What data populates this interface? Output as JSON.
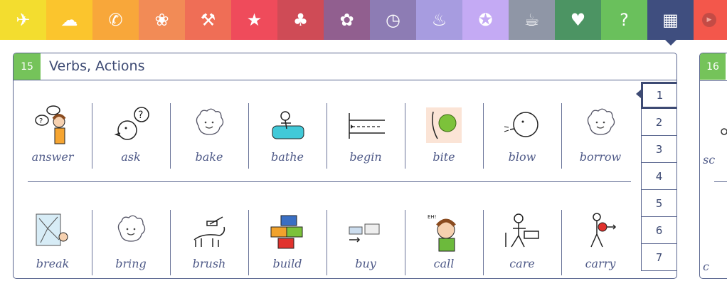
{
  "tabs": [
    {
      "icon": "airplane-icon",
      "glyph": "✈",
      "color": "#f3dd2f"
    },
    {
      "icon": "cloud-icon",
      "glyph": "☁",
      "color": "#fbc52d"
    },
    {
      "icon": "telephone-icon",
      "glyph": "✆",
      "color": "#f8a73a"
    },
    {
      "icon": "rabbit-icon",
      "glyph": "❀",
      "color": "#f28b56"
    },
    {
      "icon": "hammer-icon",
      "glyph": "⚒",
      "color": "#ef6e56"
    },
    {
      "icon": "star-icon",
      "glyph": "★",
      "color": "#ef4b5b"
    },
    {
      "icon": "tree-icon",
      "glyph": "♣",
      "color": "#cf4b56"
    },
    {
      "icon": "footprint-icon",
      "glyph": "✿",
      "color": "#915f8f"
    },
    {
      "icon": "clock-icon",
      "glyph": "◷",
      "color": "#8d7cb4"
    },
    {
      "icon": "cake-icon",
      "glyph": "♨",
      "color": "#a79ce0"
    },
    {
      "icon": "compass-icon",
      "glyph": "✪",
      "color": "#c4aaf4"
    },
    {
      "icon": "drink-icon",
      "glyph": "☕",
      "color": "#8f96a6"
    },
    {
      "icon": "heart-icon",
      "glyph": "♥",
      "color": "#4c9463"
    },
    {
      "icon": "question-icon",
      "glyph": "?",
      "color": "#6ac05c"
    },
    {
      "icon": "clapperboard-icon",
      "glyph": "▦",
      "color": "#3f4e7f"
    },
    {
      "icon": "next-icon",
      "glyph": "⏭",
      "color": "#f3574b"
    }
  ],
  "panel": {
    "number": "15",
    "title": "Verbs, Actions"
  },
  "row1": [
    "answer",
    "ask",
    "bake",
    "bathe",
    "begin",
    "bite",
    "blow",
    "borrow"
  ],
  "row2": [
    "break",
    "bring",
    "brush",
    "build",
    "buy",
    "call",
    "care",
    "carry"
  ],
  "pages": [
    "1",
    "2",
    "3",
    "4",
    "5",
    "6",
    "7"
  ],
  "active_page": "1",
  "next_panel": {
    "number": "16",
    "label_top": "sc",
    "label_bottom": "c"
  },
  "colors": {
    "panel_border": "#58648e",
    "badge_green": "#75c35a",
    "title_text": "#3d4a73",
    "label_text": "#4f5a88"
  }
}
